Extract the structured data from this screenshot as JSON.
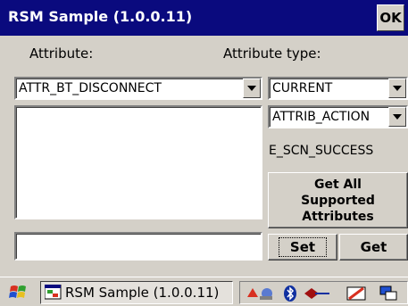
{
  "window": {
    "title": "RSM Sample (1.0.0.11)",
    "ok_label": "OK"
  },
  "labels": {
    "attribute": "Attribute:",
    "attribute_type": "Attribute type:"
  },
  "attribute_select": {
    "value": "ATTR_BT_DISCONNECT"
  },
  "type_select": {
    "value": "CURRENT"
  },
  "action_select": {
    "value": "ATTRIB_ACTION"
  },
  "status_text": "E_SCN_SUCCESS",
  "buttons": {
    "get_all_line1": "Get All",
    "get_all_line2": "Supported",
    "get_all_line3": "Attributes",
    "set": "Set",
    "get": "Get"
  },
  "taskbar": {
    "task_label": "RSM Sample (1.0.0.11)"
  },
  "icons": {
    "start": "windows-flag-icon",
    "app": "app-window-icon",
    "tray": [
      "network-icon",
      "battery-icon",
      "bluetooth-icon",
      "speaker-icon",
      "pen-icon",
      "desktop-icon"
    ]
  }
}
